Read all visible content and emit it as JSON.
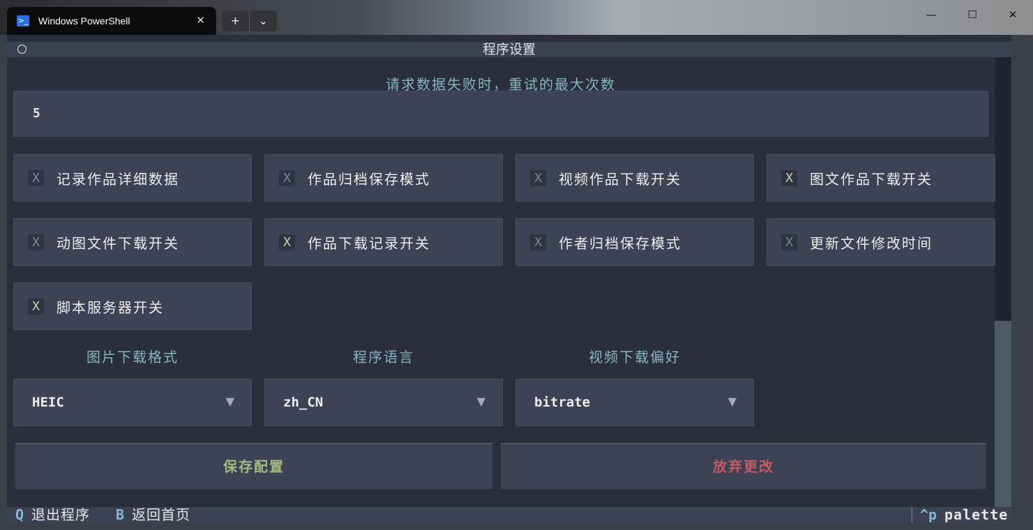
{
  "window": {
    "tab_title": "Windows PowerShell",
    "tab_icon": "powershell-icon",
    "new_tab": "+",
    "dropdown": "⌄",
    "minimize": "—",
    "maximize": "☐",
    "close": "✕"
  },
  "header": {
    "title": "程序设置"
  },
  "retry": {
    "label": "请求数据失败时，重试的最大次数",
    "value": "5"
  },
  "checkboxes": [
    {
      "label": "记录作品详细数据",
      "checked": false
    },
    {
      "label": "作品归档保存模式",
      "checked": false
    },
    {
      "label": "视频作品下载开关",
      "checked": false
    },
    {
      "label": "图文作品下载开关",
      "checked": true
    },
    {
      "label": "动图文件下载开关",
      "checked": false
    },
    {
      "label": "作品下载记录开关",
      "checked": true
    },
    {
      "label": "作者归档保存模式",
      "checked": false
    },
    {
      "label": "更新文件修改时间",
      "checked": false
    },
    {
      "label": "脚本服务器开关",
      "checked": true
    }
  ],
  "checkbox_mark": "X",
  "selects": [
    {
      "label": "图片下载格式",
      "value": "HEIC"
    },
    {
      "label": "程序语言",
      "value": "zh_CN"
    },
    {
      "label": "视频下载偏好",
      "value": "bitrate"
    }
  ],
  "select_arrow": "▼",
  "buttons": {
    "save": "保存配置",
    "discard": "放弃更改"
  },
  "footer": {
    "quit_key": "Q",
    "quit_label": "退出程序",
    "back_key": "B",
    "back_label": "返回首页",
    "palette_key": "^p",
    "palette_label": "palette"
  },
  "colors": {
    "background": "#2a2f3b",
    "panel": "#3d4354",
    "label": "#84b6c2",
    "save": "#9fbb82",
    "discard": "#c25a66"
  }
}
